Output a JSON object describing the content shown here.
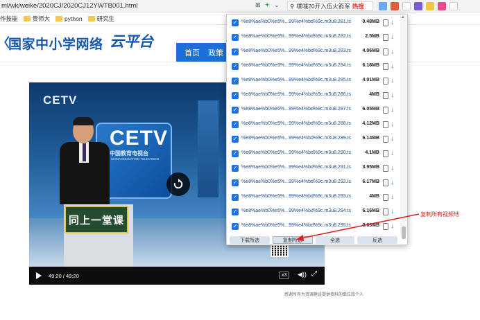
{
  "browser": {
    "url": "ml/wk/weike/2020CJ/2020CJ12YWTB001.html",
    "search_text": "噗嗤20开入伍火箭军",
    "hot_label": "热搜",
    "bookmarks": [
      {
        "label": "作技能"
      },
      {
        "label": "贵师大"
      },
      {
        "label": "python"
      },
      {
        "label": "研究生"
      }
    ]
  },
  "site": {
    "logo_text": "国家中小学网络",
    "logo_script": "云平台",
    "nav": [
      "首页",
      "政策"
    ]
  },
  "video": {
    "cetv_top": "CETV",
    "cetv_big": "CETV",
    "cetv_sub": "中国教育电视台",
    "cetv_en": "CHINA EDUCATION TELEVISION",
    "podium_sign": "同上一堂课",
    "time": "49:20 / 49:20",
    "speed": "x3"
  },
  "caption": "感谢所有为资源建设提供资料的单位和个人",
  "popup": {
    "files": [
      {
        "name": "%e8%ae%b0%e5%...99%e4%bd%9c.m3u8.281.ts",
        "size": "0.48MB"
      },
      {
        "name": "%e8%ae%b0%e5%...99%e4%bd%9c.m3u8.282.ts",
        "size": "2.5MB"
      },
      {
        "name": "%e8%ae%b0%e5%...99%e4%bd%9c.m3u8.283.ts",
        "size": "4.06MB"
      },
      {
        "name": "%e8%ae%b0%e5%...99%e4%bd%9c.m3u8.284.ts",
        "size": "6.16MB"
      },
      {
        "name": "%e8%ae%b0%e5%...99%e4%bd%9c.m3u8.285.ts",
        "size": "4.01MB"
      },
      {
        "name": "%e8%ae%b0%e5%...99%e4%bd%9c.m3u8.286.ts",
        "size": "4MB"
      },
      {
        "name": "%e8%ae%b0%e5%...99%e4%bd%9c.m3u8.287.ts",
        "size": "6.05MB"
      },
      {
        "name": "%e8%ae%b0%e5%...99%e4%bd%9c.m3u8.288.ts",
        "size": "4.12MB"
      },
      {
        "name": "%e8%ae%b0%e5%...99%e4%bd%9c.m3u8.289.ts",
        "size": "6.14MB"
      },
      {
        "name": "%e8%ae%b0%e5%...99%e4%bd%9c.m3u8.290.ts",
        "size": "4.1MB"
      },
      {
        "name": "%e8%ae%b0%e5%...99%e4%bd%9c.m3u8.291.ts",
        "size": "3.95MB"
      },
      {
        "name": "%e8%ae%b0%e5%...99%e4%bd%9c.m3u8.292.ts",
        "size": "6.17MB"
      },
      {
        "name": "%e8%ae%b0%e5%...99%e4%bd%9c.m3u8.293.ts",
        "size": "4MB"
      },
      {
        "name": "%e8%ae%b0%e5%...99%e4%bd%9c.m3u8.294.ts",
        "size": "6.16MB"
      },
      {
        "name": "%e8%ae%b0%e5%...99%e4%bd%9c.m3u8.295.ts",
        "size": "0.63MB"
      }
    ],
    "buttons": {
      "download": "下载所选",
      "copy": "复制所选",
      "select_all": "全选",
      "invert": "反选"
    }
  },
  "annotation": "复制所有视频地",
  "colors": {
    "brand_blue": "#1557b0",
    "nav_blue": "#1d6fd6",
    "checkbox": "#1a73e8",
    "annotation_red": "#e02020",
    "download_green": "#2aa84a"
  }
}
